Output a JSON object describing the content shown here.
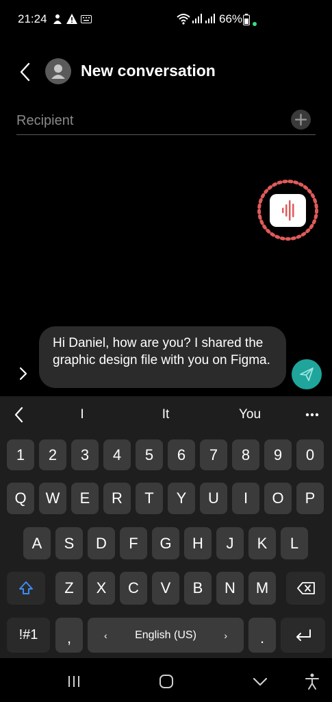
{
  "status_bar": {
    "time": "21:24",
    "battery": "66%"
  },
  "header": {
    "title": "New conversation"
  },
  "recipient": {
    "placeholder": "Recipient"
  },
  "message": {
    "text": "Hi Daniel, how are you? I shared the graphic design file with you on Figma."
  },
  "suggestions": [
    "I",
    "It",
    "You"
  ],
  "keyboard": {
    "row_numbers": [
      "1",
      "2",
      "3",
      "4",
      "5",
      "6",
      "7",
      "8",
      "9",
      "0"
    ],
    "row_q": [
      "Q",
      "W",
      "E",
      "R",
      "T",
      "Y",
      "U",
      "I",
      "O",
      "P"
    ],
    "row_a": [
      "A",
      "S",
      "D",
      "F",
      "G",
      "H",
      "J",
      "K",
      "L"
    ],
    "row_z": [
      "Z",
      "X",
      "C",
      "V",
      "B",
      "N",
      "M"
    ],
    "symbols_label": "!#1",
    "comma": ",",
    "period": ".",
    "language": "English (US)"
  },
  "colors": {
    "accent": "#1fa59c",
    "voice": "#e05a5a",
    "key": "#3b3b3b"
  }
}
